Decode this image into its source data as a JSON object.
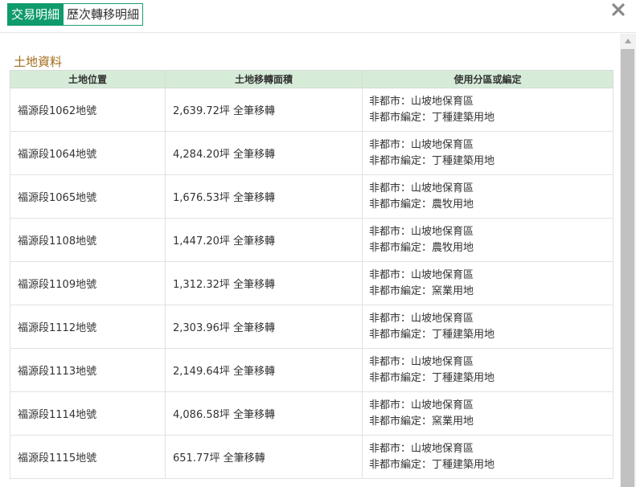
{
  "tabs": [
    {
      "label": "交易明細",
      "active": true
    },
    {
      "label": "歷次轉移明細",
      "active": false
    }
  ],
  "section_title": "土地資料",
  "table": {
    "headers": [
      "土地位置",
      "土地移轉面積",
      "使用分區或編定"
    ],
    "rows": [
      {
        "location": "福源段1062地號",
        "area": "2,639.72坪 全筆移轉",
        "zone1": "非都市：山坡地保育區",
        "zone2": "非都市編定：丁種建築用地"
      },
      {
        "location": "福源段1064地號",
        "area": "4,284.20坪 全筆移轉",
        "zone1": "非都市：山坡地保育區",
        "zone2": "非都市編定：丁種建築用地"
      },
      {
        "location": "福源段1065地號",
        "area": "1,676.53坪 全筆移轉",
        "zone1": "非都市：山坡地保育區",
        "zone2": "非都市編定：農牧用地"
      },
      {
        "location": "福源段1108地號",
        "area": "1,447.20坪 全筆移轉",
        "zone1": "非都市：山坡地保育區",
        "zone2": "非都市編定：農牧用地"
      },
      {
        "location": "福源段1109地號",
        "area": "1,312.32坪 全筆移轉",
        "zone1": "非都市：山坡地保育區",
        "zone2": "非都市編定：窯業用地"
      },
      {
        "location": "福源段1112地號",
        "area": "2,303.96坪 全筆移轉",
        "zone1": "非都市：山坡地保育區",
        "zone2": "非都市編定：丁種建築用地"
      },
      {
        "location": "福源段1113地號",
        "area": "2,149.64坪 全筆移轉",
        "zone1": "非都市：山坡地保育區",
        "zone2": "非都市編定：丁種建築用地"
      },
      {
        "location": "福源段1114地號",
        "area": "4,086.58坪 全筆移轉",
        "zone1": "非都市：山坡地保育區",
        "zone2": "非都市編定：窯業用地"
      },
      {
        "location": "福源段1115地號",
        "area": "651.77坪 全筆移轉",
        "zone1": "非都市：山坡地保育區",
        "zone2": "非都市編定：丁種建築用地"
      }
    ]
  },
  "icons": {
    "close": "close-icon",
    "scroll_up": "scroll-up-arrow-icon"
  },
  "colors": {
    "tab_active": "#0f9b6c",
    "header_row": "#d6ecd9",
    "section_title": "#a06b1a"
  }
}
